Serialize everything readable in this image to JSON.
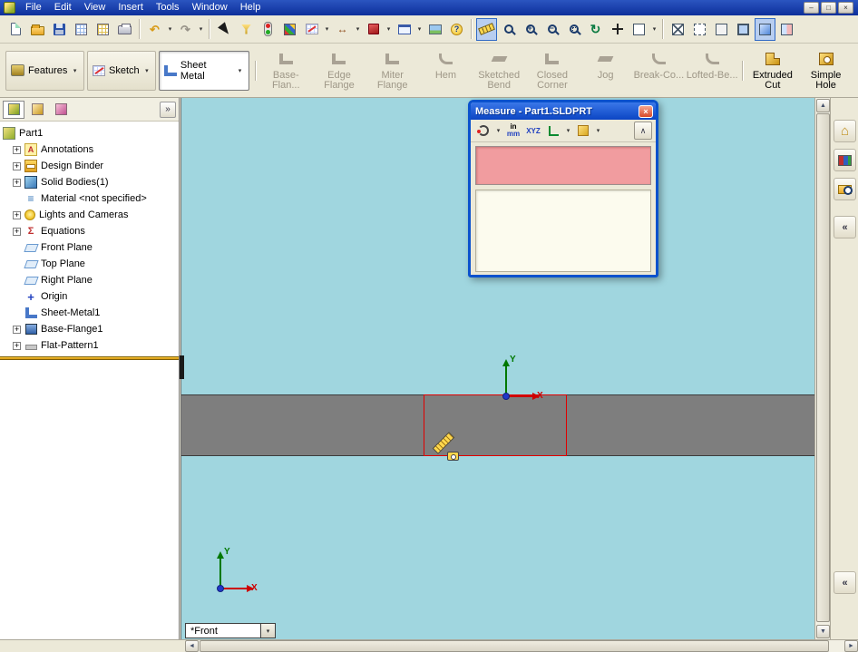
{
  "window": {
    "menu_items": [
      "File",
      "Edit",
      "View",
      "Insert",
      "Tools",
      "Window",
      "Help"
    ]
  },
  "icons": {
    "dropdown": "▾",
    "expand_plus": "+",
    "double_chevron_right": "»",
    "double_chevron_left": "«",
    "chevron_up": "∧",
    "up_arrow": "▲",
    "down_arrow": "▼",
    "left_arrow": "◄",
    "right_arrow": "►",
    "undo": "↶",
    "redo": "↷",
    "rotate": "↻",
    "home": "⌂",
    "dimension": "↔",
    "help": "?",
    "close": "×",
    "minimize": "–",
    "maximize": "□"
  },
  "ribbon": {
    "tabs": [
      {
        "label": "Features"
      },
      {
        "label": "Sketch"
      },
      {
        "label": "Sheet Metal",
        "active": true
      }
    ],
    "tools": [
      {
        "label": "Base-Flan...",
        "enabled": false
      },
      {
        "label": "Edge Flange",
        "enabled": false
      },
      {
        "label": "Miter Flange",
        "enabled": false
      },
      {
        "label": "Hem",
        "enabled": false
      },
      {
        "label": "Sketched Bend",
        "enabled": false
      },
      {
        "label": "Closed Corner",
        "enabled": false
      },
      {
        "label": "Jog",
        "enabled": false
      },
      {
        "label": "Break-Co...",
        "enabled": false
      },
      {
        "label": "Lofted-Be...",
        "enabled": false
      },
      {
        "label": "Extruded Cut",
        "enabled": true
      },
      {
        "label": "Simple Hole",
        "enabled": true
      }
    ]
  },
  "feature_tree": {
    "root": "Part1",
    "items": [
      {
        "label": "Annotations",
        "expandable": true
      },
      {
        "label": "Design Binder",
        "expandable": true
      },
      {
        "label": "Solid Bodies(1)",
        "expandable": true
      },
      {
        "label": "Material <not specified>",
        "expandable": false
      },
      {
        "label": "Lights and Cameras",
        "expandable": true
      },
      {
        "label": "Equations",
        "expandable": true
      },
      {
        "label": "Front Plane",
        "expandable": false
      },
      {
        "label": "Top Plane",
        "expandable": false
      },
      {
        "label": "Right Plane",
        "expandable": false
      },
      {
        "label": "Origin",
        "expandable": false
      },
      {
        "label": "Sheet-Metal1",
        "expandable": false
      },
      {
        "label": "Base-Flange1",
        "expandable": true
      },
      {
        "label": "Flat-Pattern1",
        "expandable": true
      }
    ]
  },
  "measure_dialog": {
    "title": "Measure - Part1.SLDPRT",
    "units_top": "in",
    "units_bottom": "mm",
    "xyz_label": "XYZ"
  },
  "viewport": {
    "view_selector": "*Front",
    "axis_x": "X",
    "axis_y": "Y"
  },
  "colors": {
    "viewport_background": "#A0D6DF",
    "part_gray": "#7E7E7E",
    "selection_red": "#E00000",
    "dialog_selection_pink": "#F19C9F",
    "titlebar_blue": "#0B45C4",
    "rollback_bar_yellow": "#FFD040"
  }
}
